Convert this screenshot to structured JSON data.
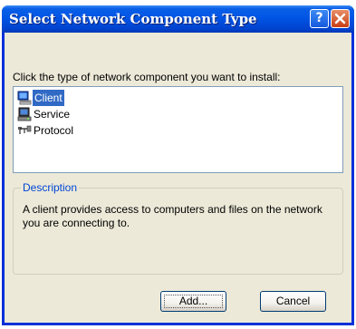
{
  "window": {
    "title": "Select Network Component Type",
    "help_label": "?",
    "close_icon": "close-icon"
  },
  "instruction": "Click the type of network component you want to install:",
  "components": [
    {
      "label": "Client",
      "icon": "client-icon",
      "selected": true
    },
    {
      "label": "Service",
      "icon": "service-icon",
      "selected": false
    },
    {
      "label": "Protocol",
      "icon": "protocol-icon",
      "selected": false
    }
  ],
  "description": {
    "legend": "Description",
    "text": "A client provides access to computers and files on the network you are connecting to."
  },
  "buttons": {
    "add": "Add...",
    "cancel": "Cancel"
  },
  "colors": {
    "title_bar": "#0055e5",
    "selection": "#316ac5",
    "legend_text": "#0046d5",
    "dialog_bg": "#ece9d8"
  }
}
